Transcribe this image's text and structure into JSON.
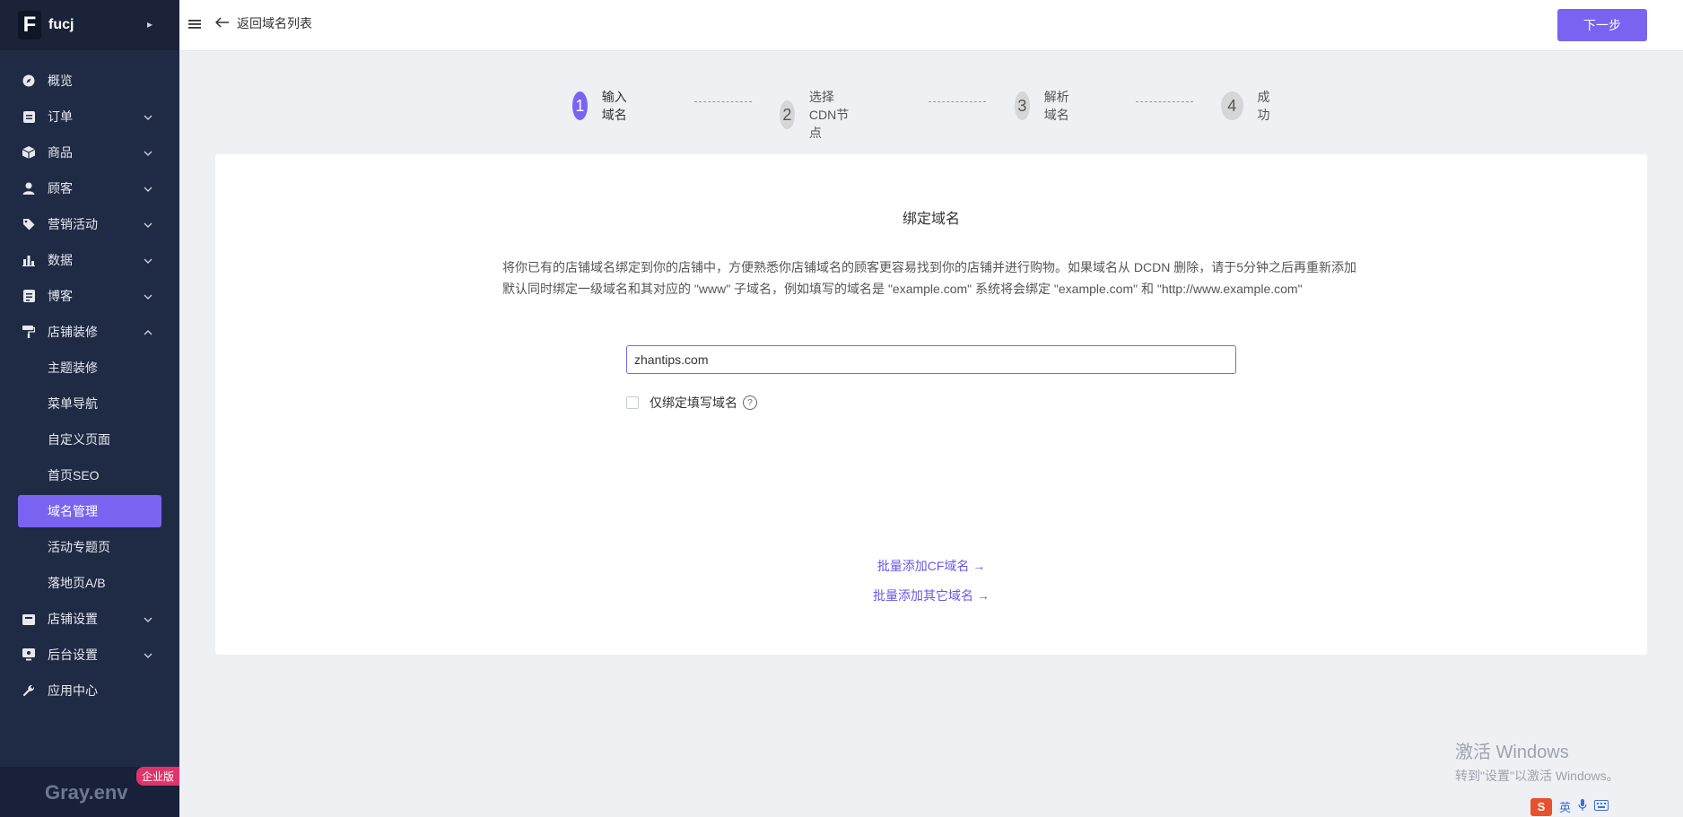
{
  "brand": {
    "letter": "F",
    "name": "fucj",
    "arrow": "▸"
  },
  "menu": [
    {
      "key": "overview",
      "label": "概览",
      "icon": "compass-icon",
      "expandable": false
    },
    {
      "key": "orders",
      "label": "订单",
      "icon": "clipboard-icon",
      "expandable": true
    },
    {
      "key": "products",
      "label": "商品",
      "icon": "cube-icon",
      "expandable": true
    },
    {
      "key": "customers",
      "label": "顾客",
      "icon": "user-icon",
      "expandable": true
    },
    {
      "key": "marketing",
      "label": "营销活动",
      "icon": "tag-icon",
      "expandable": true
    },
    {
      "key": "data",
      "label": "数据",
      "icon": "bar-chart-icon",
      "expandable": true
    },
    {
      "key": "blog",
      "label": "博客",
      "icon": "document-icon",
      "expandable": true
    },
    {
      "key": "decor",
      "label": "店铺装修",
      "icon": "paint-roller-icon",
      "expandable": true,
      "expanded": true
    }
  ],
  "submenu": [
    {
      "label": "主题装修"
    },
    {
      "label": "菜单导航"
    },
    {
      "label": "自定义页面"
    },
    {
      "label": "首页SEO"
    },
    {
      "label": "域名管理",
      "active": true
    },
    {
      "label": "活动专题页"
    },
    {
      "label": "落地页A/B"
    }
  ],
  "menu2": [
    {
      "label": "店铺设置",
      "icon": "store-icon",
      "expandable": true
    },
    {
      "label": "后台设置",
      "icon": "monitor-icon",
      "expandable": true
    },
    {
      "label": "应用中心",
      "icon": "wrench-icon",
      "expandable": false
    }
  ],
  "footer": {
    "env": "Gray.env",
    "badge": "企业版"
  },
  "header": {
    "back_label": "返回域名列表",
    "next_label": "下一步"
  },
  "steps": [
    {
      "num": "1",
      "label": "输入域名",
      "active": true
    },
    {
      "num": "2",
      "label": "选择CDN节点",
      "active": false
    },
    {
      "num": "3",
      "label": "解析域名",
      "active": false
    },
    {
      "num": "4",
      "label": "成功",
      "active": false
    }
  ],
  "card": {
    "title": "绑定域名",
    "desc_line1": "将你已有的店铺域名绑定到你的店铺中，方便熟悉你店铺域名的顾客更容易找到你的店铺并进行购物。如果域名从 DCDN 删除，请于5分钟之后再重新添加",
    "desc_line2": "默认同时绑定一级域名和其对应的 \"www\" 子域名，例如填写的域名是 \"example.com\" 系统将会绑定 \"example.com\" 和 \"http://www.example.com\"",
    "domain_value": "zhantips.com",
    "checkbox_label": "仅绑定填写域名",
    "help_symbol": "?",
    "link_cf": "批量添加CF域名 →",
    "link_other": "批量添加其它域名 →"
  },
  "windows": {
    "line1": "激活 Windows",
    "line2": "转到\"设置\"以激活 Windows。"
  },
  "tray": {
    "ime": "S",
    "lang": "英"
  },
  "colors": {
    "accent": "#7b63f2",
    "sidebar": "#1f2a44",
    "badge": "#e0336b"
  }
}
